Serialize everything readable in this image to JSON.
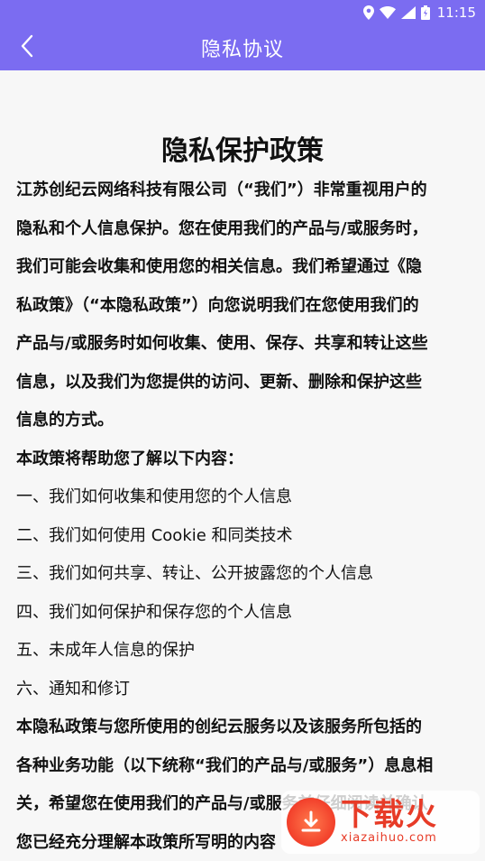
{
  "status_bar": {
    "time": "11:15",
    "icons": [
      "location-icon",
      "wifi-icon",
      "signal-icon",
      "battery-icon"
    ]
  },
  "app_bar": {
    "title": "隐私协议",
    "back_icon": "chevron-left-icon"
  },
  "document": {
    "title": "隐私保护政策",
    "intro_lines": [
      "江苏创纪云网络科技有限公司（“我们”）非常重视用户的",
      "隐私和个人信息保护。您在使用我们的产品与/或服务时，",
      "我们可能会收集和使用您的相关信息。我们希望通过《隐",
      "私政策》（“本隐私政策”）向您说明我们在您使用我们的",
      "产品与/或服务时如何收集、使用、保存、共享和转让这些",
      "信息，以及我们为您提供的访问、更新、删除和保护这些",
      "信息的方式。"
    ],
    "toc_heading": "本政策将帮助您了解以下内容：",
    "toc_items": [
      "一、我们如何收集和使用您的个人信息",
      "二、我们如何使用 Cookie 和同类技术",
      "三、我们如何共享、转让、公开披露您的个人信息",
      "四、我们如何保护和保存您的个人信息",
      "五、未成年人信息的保护",
      "六、通知和修订"
    ],
    "closing_lines": [
      "本隐私政策与您所使用的创纪云服务以及该服务所包括的",
      "各种业务功能（以下统称“我们的产品与/或服务”）息息相",
      "关，希望您在使用我们的产品与/或服务前仔细阅读并确认",
      "您已经充分理解本政策所写明的内容"
    ]
  },
  "watermark": {
    "brand": "下载火",
    "url": "xiazaihuo.com"
  },
  "colors": {
    "primary": "#7b6cf1",
    "background": "#f7f7f7",
    "text": "#111111",
    "watermark": "#e73b27"
  }
}
